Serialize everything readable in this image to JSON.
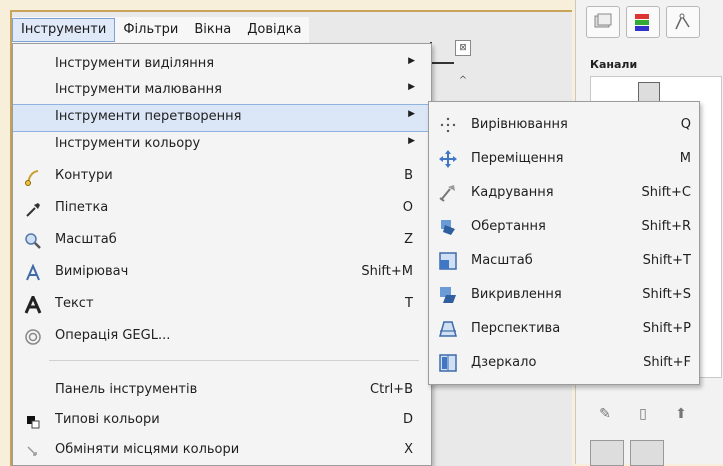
{
  "menubar": {
    "items": [
      {
        "label": "Інструменти",
        "active": true
      },
      {
        "label": "Фільтри"
      },
      {
        "label": "Вікна"
      },
      {
        "label": "Довідка"
      }
    ]
  },
  "menu": {
    "items": [
      {
        "label": "Інструменти виділяння",
        "shortcut": "",
        "submenu": true
      },
      {
        "label": "Інструменти малювання",
        "shortcut": "",
        "submenu": true
      },
      {
        "label": "Інструменти перетворення",
        "shortcut": "",
        "submenu": true,
        "highlighted": true
      },
      {
        "label": "Інструменти кольору",
        "shortcut": "",
        "submenu": true
      },
      {
        "label": "Контури",
        "shortcut": "B",
        "icon": "paths-icon"
      },
      {
        "label": "Піпетка",
        "shortcut": "O",
        "icon": "color-picker-icon"
      },
      {
        "label": "Масштаб",
        "shortcut": "Z",
        "icon": "zoom-icon"
      },
      {
        "label": "Вимірювач",
        "shortcut": "Shift+M",
        "icon": "measure-icon"
      },
      {
        "label": "Текст",
        "shortcut": "T",
        "icon": "text-icon"
      },
      {
        "label": "Операція GEGL...",
        "shortcut": "",
        "icon": "gegl-icon"
      },
      {
        "label": "Панель інструментів",
        "shortcut": "Ctrl+B"
      },
      {
        "label": "Типові кольори",
        "shortcut": "D",
        "icon": "default-colors-icon"
      },
      {
        "label": "Обміняти місцями кольори",
        "shortcut": "X",
        "icon": "swap-colors-icon"
      }
    ]
  },
  "submenu": {
    "items": [
      {
        "label": "Вирівнювання",
        "shortcut": "Q",
        "icon": "align-icon"
      },
      {
        "label": "Переміщення",
        "shortcut": "M",
        "icon": "move-icon"
      },
      {
        "label": "Кадрування",
        "shortcut": "Shift+C",
        "icon": "crop-icon"
      },
      {
        "label": "Обертання",
        "shortcut": "Shift+R",
        "icon": "rotate-icon"
      },
      {
        "label": "Масштаб",
        "shortcut": "Shift+T",
        "icon": "scale-icon"
      },
      {
        "label": "Викривлення",
        "shortcut": "Shift+S",
        "icon": "shear-icon"
      },
      {
        "label": "Перспектива",
        "shortcut": "Shift+P",
        "icon": "perspective-icon"
      },
      {
        "label": "Дзеркало",
        "shortcut": "Shift+F",
        "icon": "flip-icon"
      }
    ]
  },
  "dock": {
    "title": "Канали"
  },
  "colors": {
    "highlight": "#dbe7f7",
    "menu_bg": "#f4f4f4",
    "frame": "#c9a55b"
  }
}
